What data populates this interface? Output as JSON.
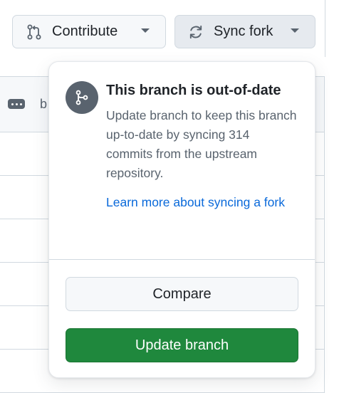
{
  "toolbar": {
    "contribute_label": "Contribute",
    "contribute_icon": "pull-request-icon",
    "sync_label": "Sync fork",
    "sync_icon": "sync-icon"
  },
  "file_list": {
    "header_truncated_text": "b",
    "menu_icon": "kebab-horizontal-icon"
  },
  "popover": {
    "icon": "git-branch-icon",
    "title": "This branch is out-of-date",
    "description": "Update branch to keep this branch up-to-date by syncing 314 commits from the upstream repository.",
    "learn_more_link": "Learn more about syncing a fork",
    "compare_label": "Compare",
    "update_label": "Update branch"
  },
  "colors": {
    "accent_link": "#0969da",
    "primary_button": "#1f883d",
    "icon_badge": "#59636e",
    "border": "#d1d9e0"
  }
}
